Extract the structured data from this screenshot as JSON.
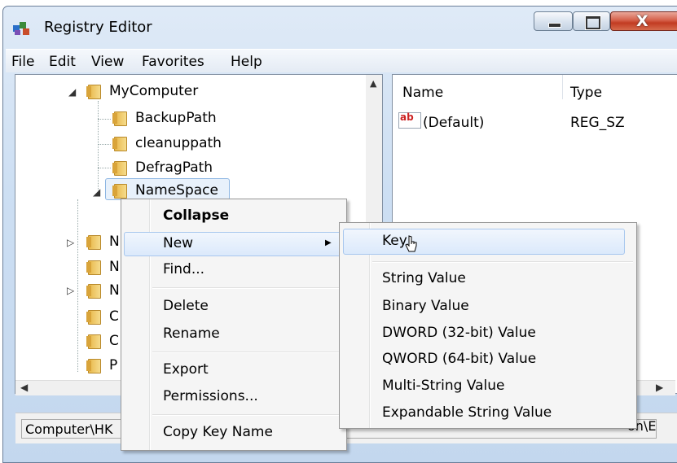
{
  "window": {
    "title": "Registry Editor",
    "close_glyph": "X"
  },
  "menubar": {
    "file": "File",
    "edit": "Edit",
    "view": "View",
    "favorites": "Favorites",
    "help": "Help"
  },
  "tree": {
    "root": "MyComputer",
    "children": [
      "BackupPath",
      "cleanuppath",
      "DefragPath",
      "NameSpace"
    ],
    "partial_labels": [
      "N",
      "N",
      "N",
      "C",
      "C",
      "P"
    ]
  },
  "list": {
    "columns": {
      "name": "Name",
      "type": "Type"
    },
    "rows": [
      {
        "name": "(Default)",
        "type": "REG_SZ",
        "icon": "reg-string-icon",
        "icon_text": "ab"
      }
    ]
  },
  "status": {
    "path_left": "Computer\\HK",
    "path_right": "on\\E"
  },
  "context_menu": {
    "items": [
      "Collapse",
      "New",
      "Find...",
      "Delete",
      "Rename",
      "Export",
      "Permissions...",
      "Copy Key Name"
    ]
  },
  "submenu": {
    "items": [
      "Key",
      "String Value",
      "Binary Value",
      "DWORD (32-bit) Value",
      "QWORD (64-bit) Value",
      "Multi-String Value",
      "Expandable String Value"
    ]
  },
  "colors": {
    "highlight_border": "#a8c7ee",
    "folder": "#e8b74a",
    "close_button": "#c23b22"
  }
}
